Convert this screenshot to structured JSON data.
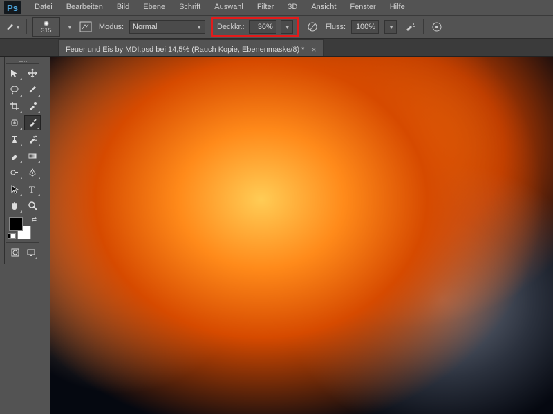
{
  "app": {
    "badge": "Ps"
  },
  "menu": [
    "Datei",
    "Bearbeiten",
    "Bild",
    "Ebene",
    "Schrift",
    "Auswahl",
    "Filter",
    "3D",
    "Ansicht",
    "Fenster",
    "Hilfe"
  ],
  "options": {
    "brush_size": "315",
    "mode_label": "Modus:",
    "mode_value": "Normal",
    "opacity_label": "Deckkr.:",
    "opacity_value": "36%",
    "flow_label": "Fluss:",
    "flow_value": "100%"
  },
  "tab": {
    "title": "Feuer und Eis by MDI.psd bei 14,5% (Rauch Kopie, Ebenenmaske/8) *"
  },
  "swatches": {
    "fg": "#000000",
    "bg": "#ffffff"
  },
  "tools": [
    "move-tool",
    "artboard-tool",
    "lasso-tool",
    "magic-wand-tool",
    "crop-tool",
    "eyedropper-tool",
    "healing-brush-tool",
    "brush-tool",
    "clone-stamp-tool",
    "history-brush-tool",
    "eraser-tool",
    "gradient-tool",
    "dodge-tool",
    "pen-tool",
    "type-tool",
    "path-select-tool",
    "rectangle-tool",
    "hand-tool",
    "zoom-tool",
    "rotate-tool"
  ]
}
